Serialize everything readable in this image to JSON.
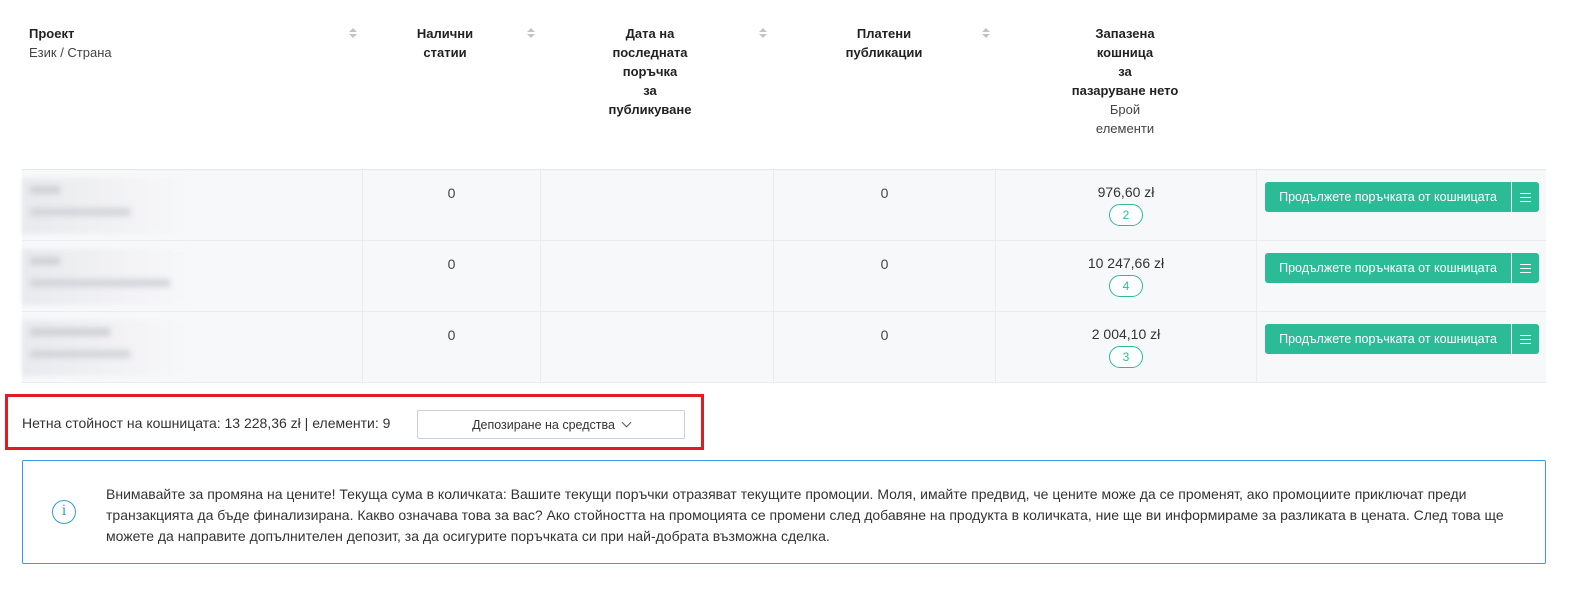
{
  "columns": {
    "project": "Проект",
    "project_sub": "Език / Страна",
    "available_articles_l1": "Налични",
    "available_articles_l2": "статии",
    "last_order_l1": "Дата на",
    "last_order_l2": "последната",
    "last_order_l3": "поръчка",
    "last_order_l4": "за",
    "last_order_l5": "публикуване",
    "paid_l1": "Платени",
    "paid_l2": "публикации",
    "cart_l1": "Запазена",
    "cart_l2": "кошница",
    "cart_l3": "за",
    "cart_l4": "пазаруване нето",
    "cart_sub_l1": "Брой",
    "cart_sub_l2": "елементи"
  },
  "rows": [
    {
      "available": "0",
      "paid": "0",
      "price": "976,60 zł",
      "count": "2"
    },
    {
      "available": "0",
      "paid": "0",
      "price": "10 247,66 zł",
      "count": "4"
    },
    {
      "available": "0",
      "paid": "0",
      "price": "2 004,10 zł",
      "count": "3"
    }
  ],
  "continue_label": "Продължете поръчката от кошницата",
  "summary": {
    "text": "Нетна стойност на кошницата: 13 228,36 zł | елементи: 9",
    "deposit_label": "Депозиране на средства"
  },
  "alert": {
    "text": "Внимавайте за промяна на цените! Текуща сума в количката: Вашите текущи поръчки отразяват текущите промоции. Моля, имайте предвид, че цените може да се променят, ако промоциите приключат преди транзакцията да бъде финализирана. Какво означава това за вас? Ако стойността на промоцията се промени след добавяне на продукта в количката, ние ще ви информираме за разликата в цената. След това ще можете да направите допълнителен депозит, за да осигурите поръчката си при най-добрата възможна сделка."
  },
  "colors": {
    "accent": "#2bbb97",
    "highlight": "#e11b22",
    "info": "#3a9be0"
  }
}
